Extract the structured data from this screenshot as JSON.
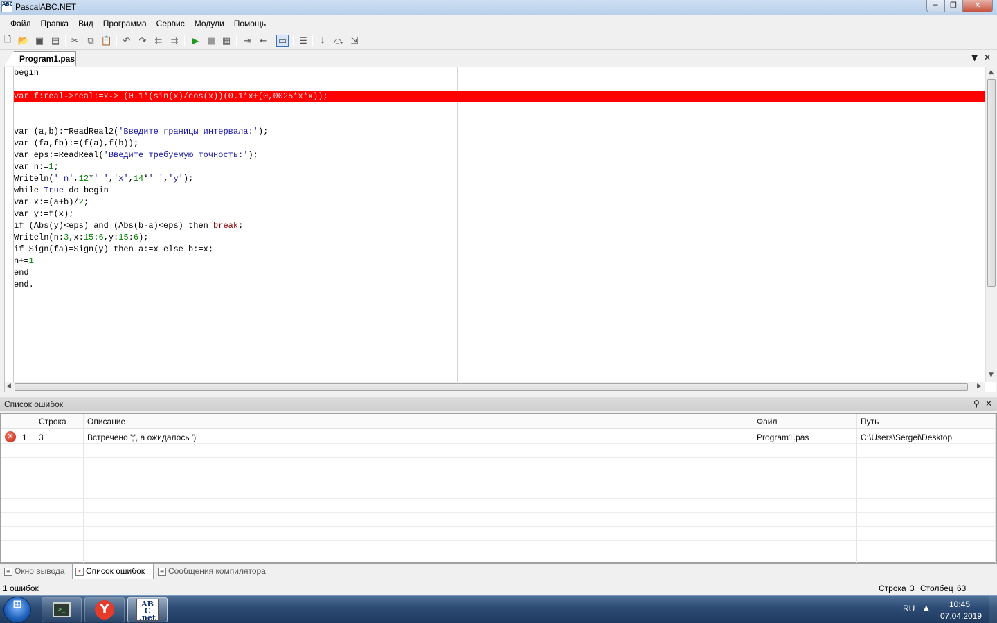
{
  "window": {
    "title": "PascalABC.NET",
    "app_icon_text": "ABC",
    "minimize": "─",
    "maximize": "❐",
    "close": "✕"
  },
  "menu": [
    "Файл",
    "Правка",
    "Вид",
    "Программа",
    "Сервис",
    "Модули",
    "Помощь"
  ],
  "toolbar": {
    "icons": [
      "new-file",
      "open",
      "save",
      "save-all",
      "cut",
      "copy",
      "paste",
      "undo",
      "redo",
      "navigate-back",
      "navigate-forward",
      "run",
      "stop",
      "debug-window",
      "indent",
      "unindent",
      "output-window",
      "format",
      "step-into",
      "step-over",
      "run-to-cursor"
    ]
  },
  "editor": {
    "tab_label": "Program1.pas",
    "tab_dropdown": "▼",
    "tab_close": "✕",
    "error_line_index": 2,
    "lines": [
      "begin",
      "",
      "var f:real->real:=x-> (0.1*(sin(x)/cos(x))(0.1*x+(0,0025*x*x));",
      "",
      "",
      "var (a,b):=ReadReal2('Введите границы интервала:');",
      "var (fa,fb):=(f(a),f(b));",
      "var eps:=ReadReal('Введите требуемую точность:');",
      "var n:=1;",
      "Writeln(' n',12*' ','x',14*' ','y');",
      "while True do begin",
      "var x:=(a+b)/2;",
      "var y:=f(x);",
      "if (Abs(y)<eps) and (Abs(b-a)<eps) then break;",
      "Writeln(n:3,x:15:6,y:15:6);",
      "if Sign(fa)=Sign(y) then a:=x else b:=x;",
      "n+=1",
      "end",
      "end."
    ]
  },
  "error_panel": {
    "title": "Список ошибок",
    "pin": "⚲",
    "close": "✕",
    "columns": [
      "",
      "",
      "Строка",
      "Описание",
      "Файл",
      "Путь"
    ],
    "rows": [
      {
        "icon": "✕",
        "num": "1",
        "line": "3",
        "description": "Встречено ';', а ожидалось ')'",
        "file": "Program1.pas",
        "path": "C:\\Users\\Sergei\\Desktop"
      }
    ]
  },
  "panel_tabs": [
    {
      "label": "Окно вывода",
      "active": false
    },
    {
      "label": "Список ошибок",
      "active": true
    },
    {
      "label": "Сообщения компилятора",
      "active": false
    }
  ],
  "status": {
    "left": "1 ошибок",
    "line_label": "Строка",
    "line_value": "3",
    "col_label": "Столбец",
    "col_value": "63"
  },
  "taskbar": {
    "start_glyph": "⊞",
    "lang": "RU",
    "tray_arrow": "▲",
    "time": "10:45",
    "date": "07.04.2019",
    "yandex_glyph": "Y",
    "abc_line1": "AB",
    "abc_line2": "C",
    "abc_line3": ".net"
  },
  "colors": {
    "error_line": "#ff0000",
    "string": "#1a1aa6",
    "number": "#008000"
  }
}
